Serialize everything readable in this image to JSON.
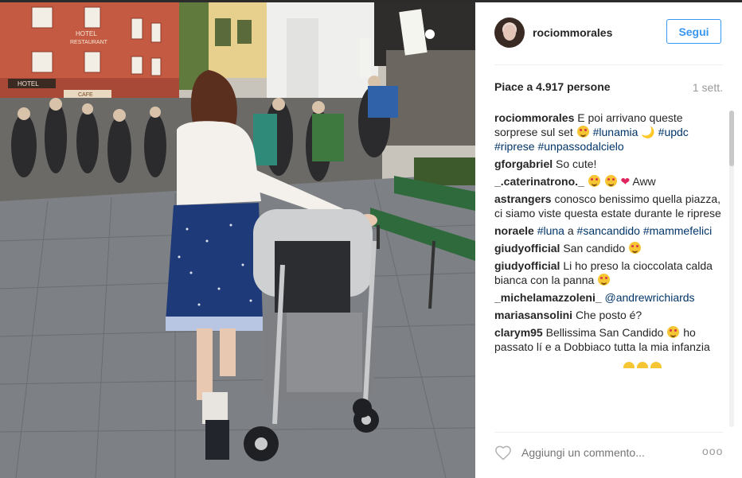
{
  "post": {
    "username": "rociommorales",
    "follow_label": "Segui",
    "likes_text": "Piace a 4.917 persone",
    "time_ago": "1 sett.",
    "photo_signs": {
      "hotel_restaurant": "HOTEL\nRESTAURANT",
      "hotel": "HOTEL",
      "cafe": "CAFE"
    }
  },
  "comments": [
    {
      "user": "rociommorales",
      "parts": [
        {
          "t": "text",
          "v": "E poi arrivano queste sorprese sul set"
        },
        {
          "t": "emoji",
          "v": "heart-eyes"
        },
        {
          "t": "tag",
          "v": "#lunamia"
        },
        {
          "t": "moon",
          "v": "🌙"
        },
        {
          "t": "tag",
          "v": "#updc"
        },
        {
          "t": "tag",
          "v": "#riprese"
        },
        {
          "t": "tag",
          "v": "#unpassodalcielo"
        }
      ]
    },
    {
      "user": "gforgabriel",
      "parts": [
        {
          "t": "text",
          "v": "So cute!"
        }
      ]
    },
    {
      "user": "_.caterinatrono._",
      "parts": [
        {
          "t": "emoji",
          "v": "heart-eyes"
        },
        {
          "t": "emoji",
          "v": "heart-eyes"
        },
        {
          "t": "heart",
          "v": "❤"
        },
        {
          "t": "text",
          "v": "Aww"
        }
      ]
    },
    {
      "user": "astrangers",
      "parts": [
        {
          "t": "text",
          "v": "conosco benissimo quella piazza, ci siamo viste questa estate durante le riprese"
        }
      ]
    },
    {
      "user": "noraele",
      "parts": [
        {
          "t": "tag",
          "v": "#luna"
        },
        {
          "t": "text",
          "v": "a"
        },
        {
          "t": "tag",
          "v": "#sancandido"
        },
        {
          "t": "tag",
          "v": "#mammefelici"
        }
      ]
    },
    {
      "user": "giudyofficial",
      "parts": [
        {
          "t": "text",
          "v": "San candido"
        },
        {
          "t": "emoji",
          "v": "heart-eyes"
        }
      ]
    },
    {
      "user": "giudyofficial",
      "parts": [
        {
          "t": "text",
          "v": "Li ho preso la cioccolata calda bianca con la panna"
        },
        {
          "t": "emoji",
          "v": "heart-eyes"
        }
      ]
    },
    {
      "user": "_michelamazzoleni_",
      "parts": [
        {
          "t": "tag",
          "v": "@andrewrichiards"
        }
      ]
    },
    {
      "user": "mariasansolini",
      "parts": [
        {
          "t": "text",
          "v": "Che posto é?"
        }
      ]
    },
    {
      "user": "clarym95",
      "parts": [
        {
          "t": "text",
          "v": "Bellissima San Candido"
        },
        {
          "t": "emoji",
          "v": "heart-eyes"
        },
        {
          "t": "text",
          "v": "ho passato lí e a Dobbiaco tutta la mia infanzia"
        }
      ]
    }
  ],
  "footer": {
    "comment_placeholder": "Aggiungi un commento...",
    "more_label": "ooo",
    "like_icon": "heart-outline-icon"
  },
  "colors": {
    "accent": "#3897f0",
    "link": "#003569",
    "muted": "#999999"
  }
}
